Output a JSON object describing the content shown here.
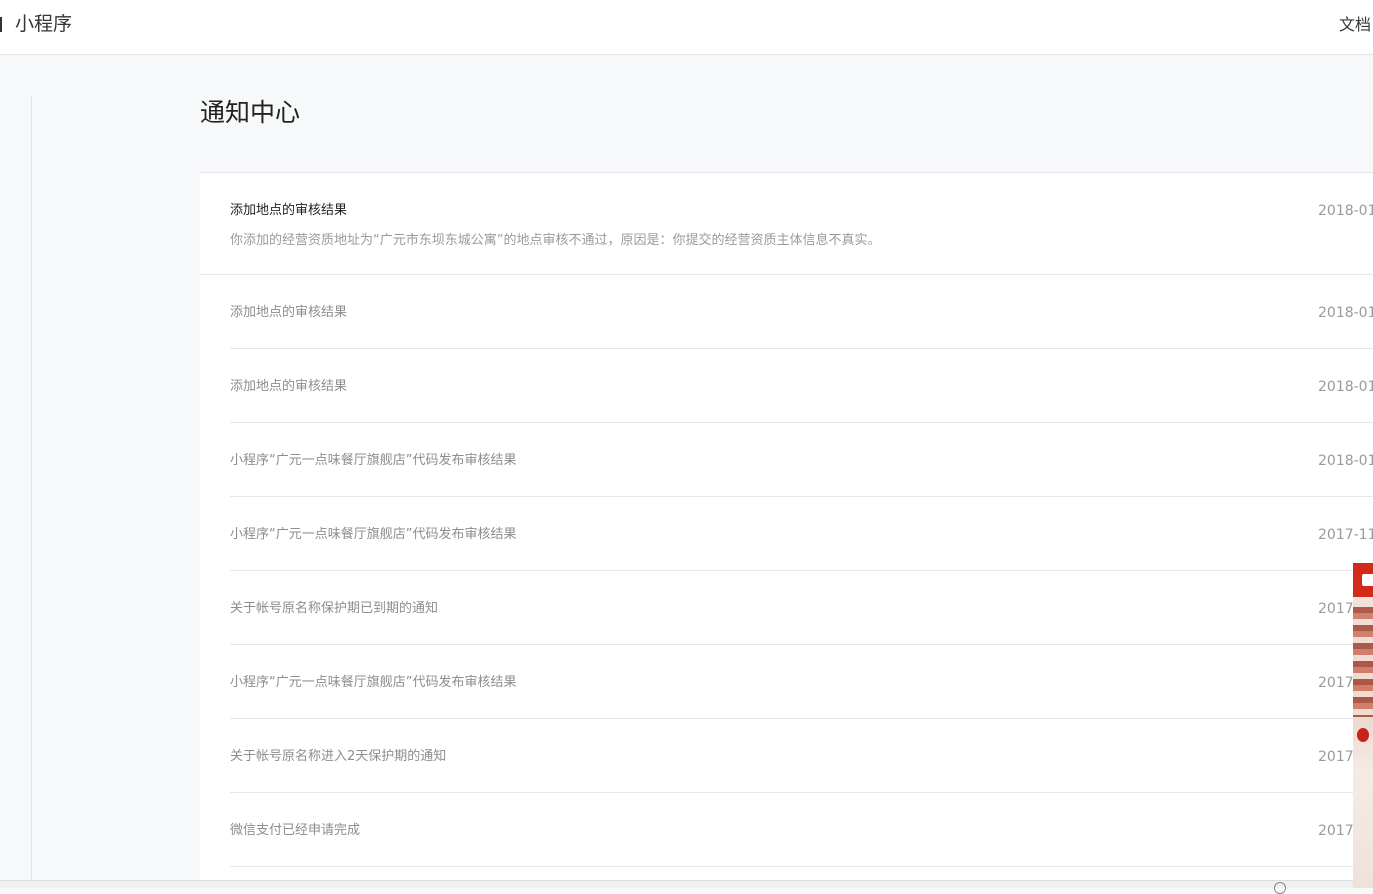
{
  "header": {
    "brand": "小程序",
    "docs_label": "文档"
  },
  "page_title": "通知中心",
  "expanded_notice": {
    "title": "添加地点的审核结果",
    "description": "你添加的经营资质地址为“广元市东坝东城公寓”的地点审核不通过，原因是：你提交的经营资质主体信息不真实。",
    "date": "2018-01"
  },
  "notices": [
    {
      "title": "添加地点的审核结果",
      "date": "2018-01"
    },
    {
      "title": "添加地点的审核结果",
      "date": "2018-01"
    },
    {
      "title": "小程序“广元一点味餐厅旗舰店”代码发布审核结果",
      "date": "2018-01"
    },
    {
      "title": "小程序“广元一点味餐厅旗舰店”代码发布审核结果",
      "date": "2017-11"
    },
    {
      "title": "关于帐号原名称保护期已到期的通知",
      "date": "2017-"
    },
    {
      "title": "小程序“广元一点味餐厅旗舰店”代码发布审核结果",
      "date": "2017-"
    },
    {
      "title": "关于帐号原名称进入2天保护期的通知",
      "date": "2017-"
    },
    {
      "title": "微信支付已经申请完成",
      "date": "2017-"
    }
  ],
  "colors": {
    "background": "#f6f8f9",
    "accent_ad": "#d42a1a"
  }
}
